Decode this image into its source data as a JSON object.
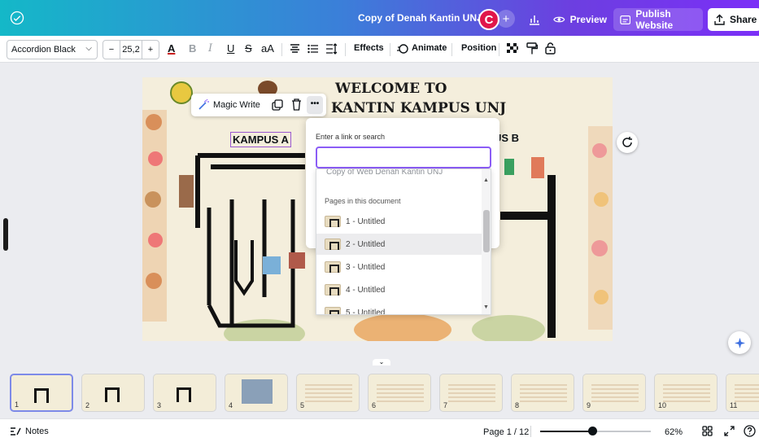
{
  "header": {
    "doc_title": "Copy of Denah Kantin UNJ",
    "avatar_letter": "C",
    "plus": "+",
    "preview": "Preview",
    "publish": "Publish Website",
    "share": "Share",
    "gradient": [
      "#14b8c8",
      "#7b2ff7"
    ]
  },
  "toolbar": {
    "font": "Accordion Black",
    "minus": "−",
    "size": "25,2",
    "plus": "+",
    "text_color_glyph": "A",
    "bold": "B",
    "italic": "I",
    "underline": "U",
    "strike": "S",
    "case": "aA",
    "effects": "Effects",
    "animate": "Animate",
    "position": "Position"
  },
  "canvas": {
    "welcome_line1": "WELCOME TO",
    "welcome_line2": "H KANTIN KAMPUS UNJ",
    "kampus_a": "KAMPUS A",
    "kampus_b": "US B",
    "magic_write": "Magic Write",
    "more": "•••"
  },
  "link_panel": {
    "label": "Enter a link or search",
    "input_value": "",
    "cut_item": "Copy of Web Denah Kantin UNJ",
    "section": "Pages in this document",
    "items": [
      {
        "label": "1 - Untitled"
      },
      {
        "label": "2 - Untitled"
      },
      {
        "label": "3 - Untitled"
      },
      {
        "label": "4 - Untitled"
      },
      {
        "label": "5 - Untitled"
      }
    ]
  },
  "filmstrip": {
    "slides": [
      "1",
      "2",
      "3",
      "4",
      "5",
      "6",
      "7",
      "8",
      "9",
      "10",
      "11"
    ]
  },
  "status": {
    "notes": "Notes",
    "page": "Page 1 / 12",
    "zoom": "62%",
    "zoom_level": 0.47
  }
}
